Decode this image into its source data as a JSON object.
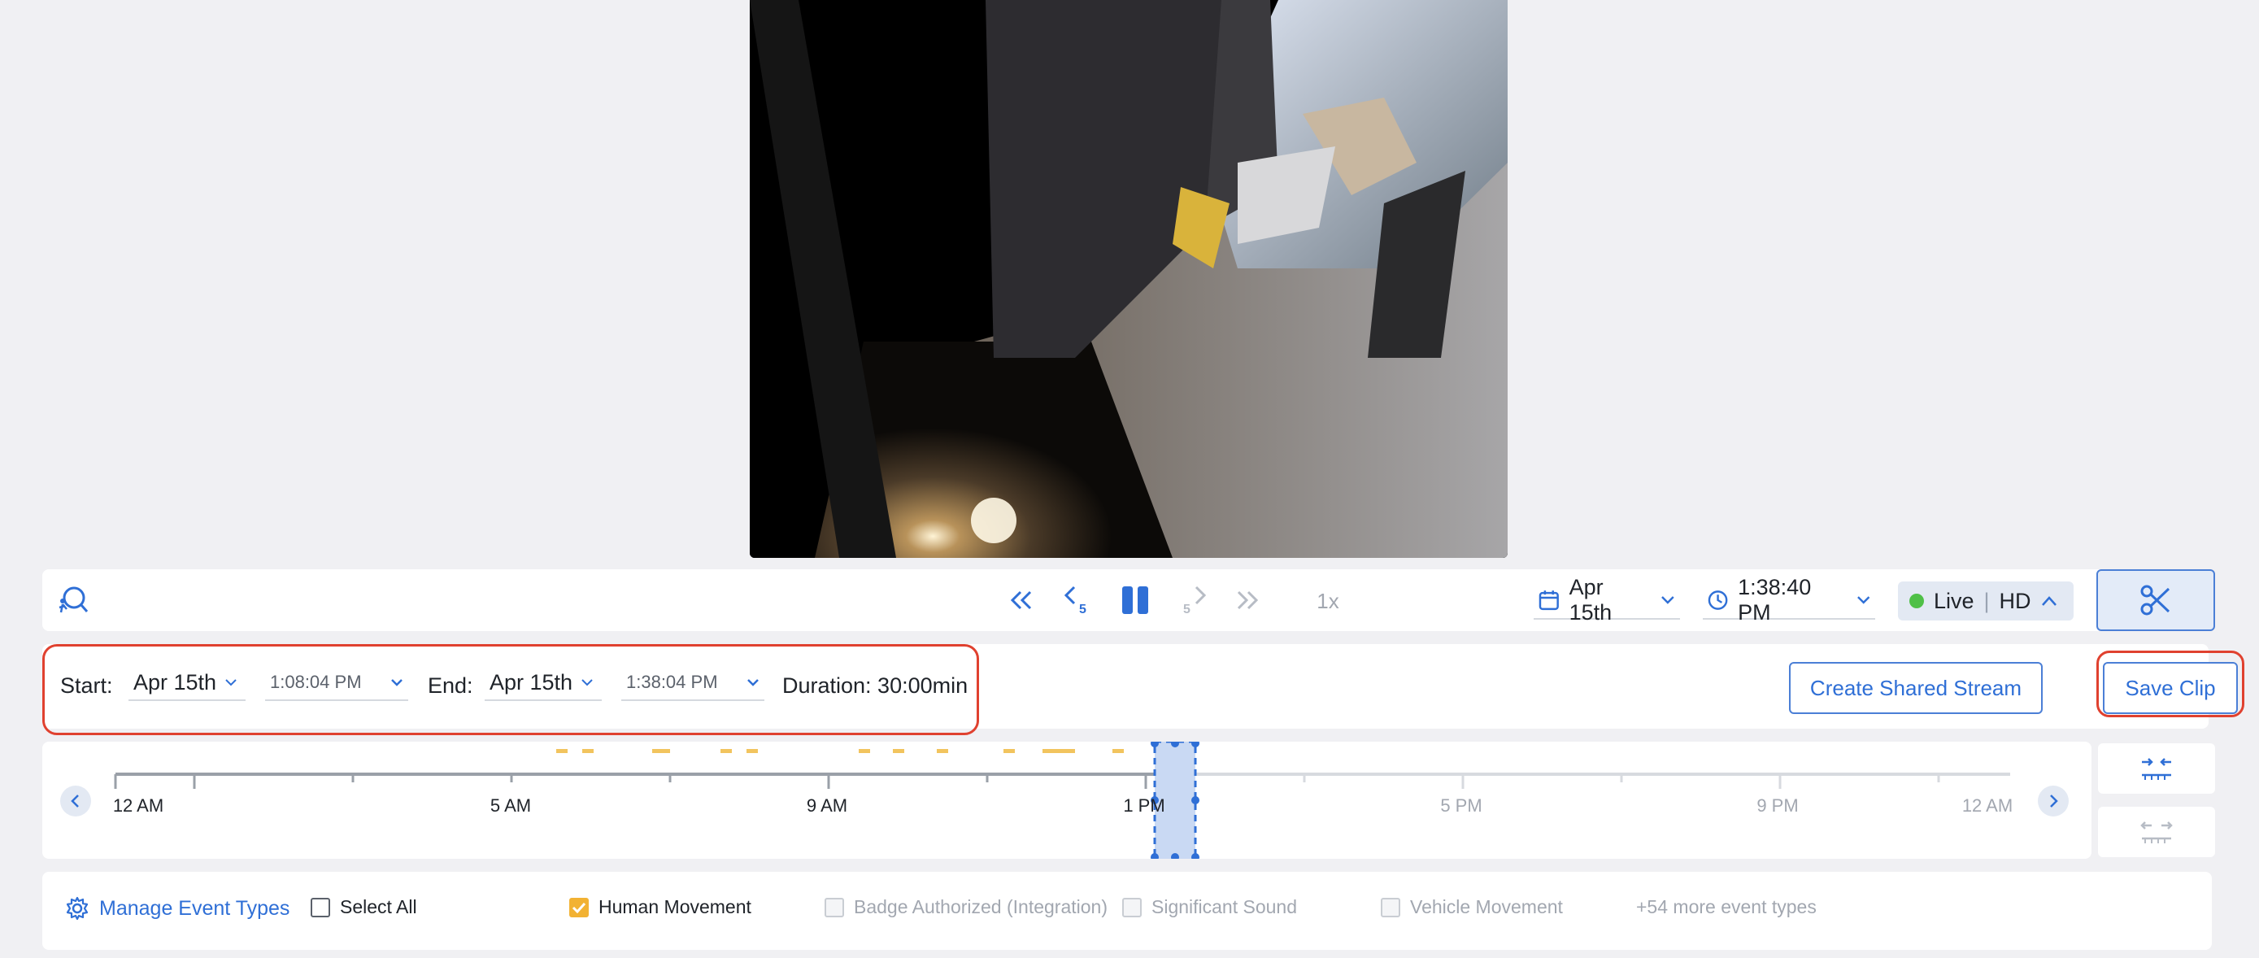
{
  "controls": {
    "date": "Apr 15th",
    "time": "1:38:40 PM",
    "speed": "1x",
    "live_label": "Live",
    "quality_label": "HD",
    "skip_back_label": "5",
    "skip_fwd_label": "5",
    "icons": [
      "motion-search-icon",
      "rewind-icon",
      "skip-back-5-icon",
      "pause-icon",
      "skip-forward-5-icon",
      "fast-forward-icon",
      "calendar-icon",
      "clock-icon",
      "chevron-up-icon",
      "scissors-icon"
    ]
  },
  "clip": {
    "start_label": "Start:",
    "start_date": "Apr 15th",
    "start_time": "1:08:04 PM",
    "end_label": "End:",
    "end_date": "Apr 15th",
    "end_time": "1:38:04 PM",
    "duration": "Duration: 30:00min",
    "create_stream_label": "Create Shared Stream",
    "save_label": "Save Clip"
  },
  "timeline": {
    "labels": [
      "12 AM",
      "5 AM",
      "9 AM",
      "1 PM",
      "5 PM",
      "9 PM",
      "12 AM"
    ],
    "colors": {
      "event": "#f2c45e",
      "selection": "#4b7fd6",
      "accent": "#2f6fd6"
    }
  },
  "events": {
    "manage_label": "Manage Event Types",
    "select_all_label": "Select All",
    "types": [
      {
        "label": "Human Movement",
        "checked": true,
        "enabled": true
      },
      {
        "label": "Badge Authorized (Integration)",
        "checked": false,
        "enabled": false
      },
      {
        "label": "Significant Sound",
        "checked": false,
        "enabled": false
      },
      {
        "label": "Vehicle Movement",
        "checked": false,
        "enabled": false
      }
    ],
    "more_label": "+54 more event types"
  }
}
